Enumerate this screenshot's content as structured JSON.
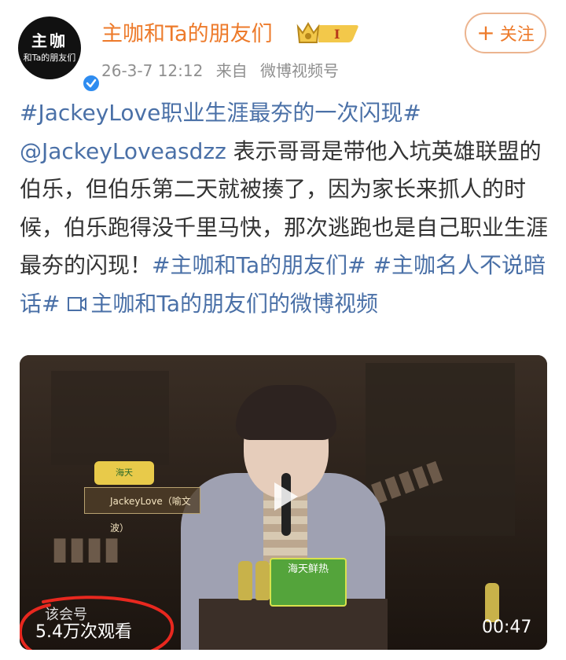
{
  "header": {
    "avatar_line1": "主咖",
    "avatar_line2": "和Ta的朋友们",
    "user_name": "主咖和Ta的朋友们",
    "badge_level": "I",
    "timestamp": "26-3-7 12:12",
    "source_prefix": "来自",
    "source": "微博视频号",
    "follow_label": "关注"
  },
  "post": {
    "hashtag_main": "#JackeyLove职业生涯最夯的一次闪现#",
    "mention": "@JackeyLoveasdzz",
    "body": " 表示哥哥是带他入坑英雄联盟的伯乐，但伯乐第二天就被揍了，因为家长来抓人的时候，伯乐跑得没千里马快，那次逃跑也是自己职业生涯最夯的闪现！",
    "hashtag_2": "#主咖和Ta的朋友们#",
    "hashtag_3": "#主咖名人不说暗话#",
    "video_link": "主咖和Ta的朋友们的微博视频"
  },
  "video": {
    "name_plate": "JackeyLove（喻文波）",
    "brand_mini": "海天",
    "sponsor": "海天鲜热",
    "watermark": "该会号",
    "view_count": "5.4万次观看",
    "duration": "00:47"
  },
  "colors": {
    "accent_orange": "#ed7a2a",
    "link_blue": "#4a70a7",
    "annotation_red": "#e8281f"
  }
}
